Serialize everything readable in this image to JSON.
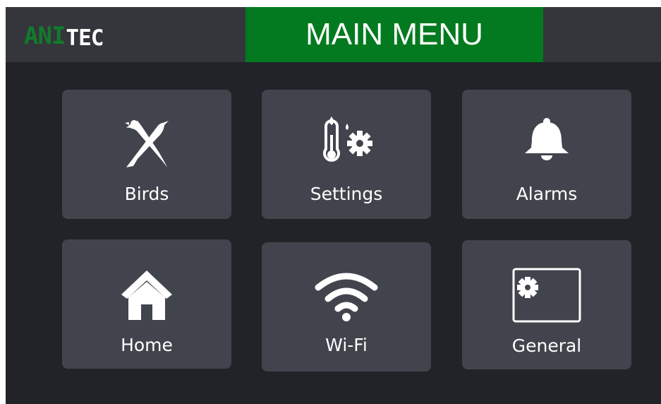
{
  "header": {
    "logo": {
      "part1": "ANI",
      "part2": "TEC"
    },
    "title": "MAIN MENU"
  },
  "tiles": [
    {
      "label": "Birds",
      "icon": "birds-icon"
    },
    {
      "label": "Settings",
      "icon": "thermometer-gear-icon"
    },
    {
      "label": "Alarms",
      "icon": "bell-icon"
    },
    {
      "label": "Home",
      "icon": "home-icon"
    },
    {
      "label": "Wi-Fi",
      "icon": "wifi-icon"
    },
    {
      "label": "General",
      "icon": "screen-gear-icon"
    }
  ],
  "colors": {
    "background": "#222328",
    "header": "#34363c",
    "title_bar": "#037a1f",
    "logo_green": "#127a2b",
    "tile": "#42444d",
    "text": "#ffffff"
  }
}
